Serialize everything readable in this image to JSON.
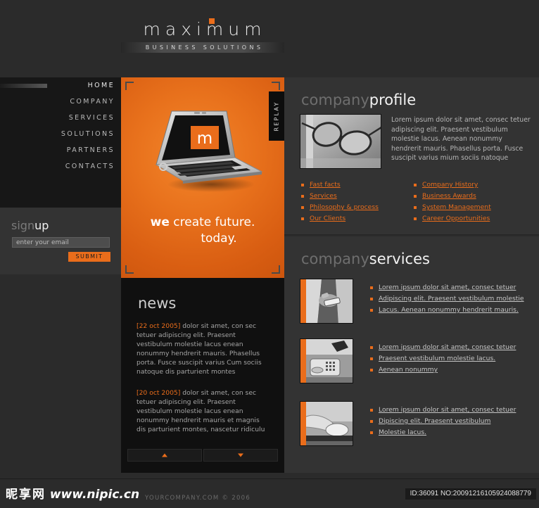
{
  "brand": {
    "name": "maximum",
    "tagline": "BUSINESS SOLUTIONS",
    "accent_color": "#ea6d1b",
    "dot_icon": "square-dot-icon"
  },
  "nav": {
    "items": [
      {
        "label": "HOME",
        "active": true
      },
      {
        "label": "COMPANY",
        "active": false
      },
      {
        "label": "SERVICES",
        "active": false
      },
      {
        "label": "SOLUTIONS",
        "active": false
      },
      {
        "label": "PARTNERS",
        "active": false
      },
      {
        "label": "CONTACTS",
        "active": false
      }
    ]
  },
  "signup": {
    "title_a": "sign",
    "title_b": "up",
    "placeholder": "enter your email",
    "value": "",
    "submit_label": "SUBMIT"
  },
  "hero": {
    "replay_label": "REPLAY",
    "tagline_1a": "we",
    "tagline_1b": "create future.",
    "tagline_2": "today.",
    "laptop_screen_letter": "m",
    "background_color": "#e8711c"
  },
  "news": {
    "title": "news",
    "items": [
      {
        "date": "[22 oct 2005]",
        "text": " dolor sit amet, con sec tetuer adipiscing elit. Praesent vestibulum molestie lacus enean nonummy hendrerit mauris. Phasellus porta. Fusce suscipit varius Cum sociis natoque dis parturient montes"
      },
      {
        "date": "[20 oct 2005]",
        "text": " dolor sit amet, con sec tetuer adipiscing elit. Praesent vestibulum molestie lacus enean nonummy hendrerit mauris et magnis dis parturient montes, nascetur ridiculu"
      }
    ],
    "prev_icon": "triangle-up-icon",
    "next_icon": "triangle-down-icon"
  },
  "profile": {
    "title_a": "company",
    "title_b": "profile",
    "image_alt": "eyeglasses-photo",
    "body": "Lorem ipsum dolor sit amet, consec tetuer adipiscing elit. Praesent vestibulum molestie lacus. Aenean nonummy hendrerit mauris. Phasellus porta. Fusce suscipit varius mium sociis natoque",
    "links_left": [
      "Fast facts",
      "Services",
      "Philosophy & process",
      "Our Clients "
    ],
    "links_right": [
      "Company History",
      "Business Awards",
      "System Management",
      "Career Opportunities "
    ]
  },
  "services": {
    "title_a": "company",
    "title_b": "services",
    "blocks": [
      {
        "image_alt": "hand-with-pda-photo",
        "links": [
          "Lorem ipsum dolor sit amet, consec tetuer",
          "Adipiscing elit. Praesent vestibulum molestie",
          "Lacus. Aenean nonummy hendrerit mauris."
        ]
      },
      {
        "image_alt": "desk-telephone-photo",
        "links": [
          "Lorem ipsum dolor sit amet, consec tetuer",
          "Praesent vestibulum molestie lacus.",
          "Aenean nonummy"
        ]
      },
      {
        "image_alt": "hand-on-mouse-photo",
        "links": [
          "Lorem ipsum dolor sit amet, consec tetuer",
          "Dipiscing elit. Praesent vestibulum",
          "Molestie lacus."
        ]
      }
    ]
  },
  "footer": {
    "watermark_cjk": "昵享网",
    "watermark_url": "www.nipic.cn",
    "copyright": "YOURCOMPANY.COM © 2006",
    "id_badge": "ID:36091 NO:20091216105924088779"
  }
}
